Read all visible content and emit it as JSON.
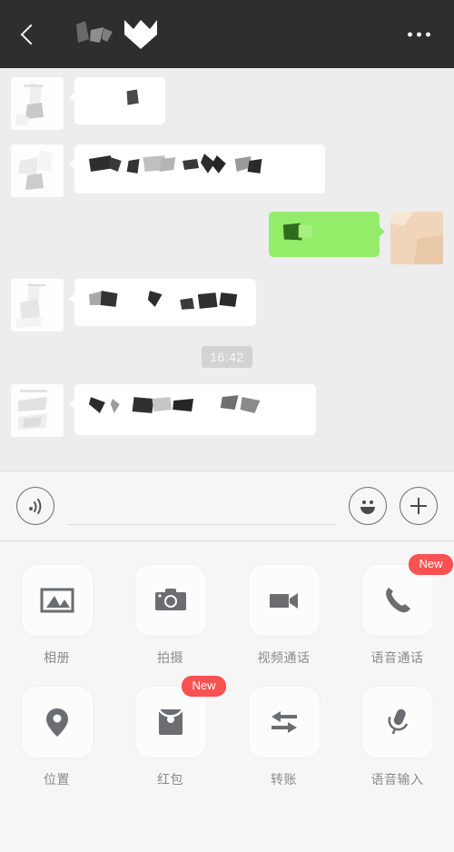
{
  "header": {
    "back_icon": "chevron-left-icon",
    "title_redacted": true,
    "more_icon": "more-horizontal-icon",
    "background_color": "#2e2e2e"
  },
  "chat": {
    "background_color": "#ededed",
    "incoming_bubble_color": "#ffffff",
    "outgoing_bubble_color": "#95ec69",
    "messages": [
      {
        "id": "msg-1",
        "direction": "in",
        "content_redacted": true,
        "bubble_width": 100,
        "bubble_height": 52,
        "avatar_type": "redacted-photo"
      },
      {
        "id": "msg-2",
        "direction": "in",
        "content_redacted": true,
        "bubble_width": 276,
        "bubble_height": 54,
        "avatar_type": "redacted-photo"
      },
      {
        "id": "msg-3",
        "direction": "out",
        "content_redacted": true,
        "bubble_width": 122,
        "bubble_height": 50,
        "avatar_type": "skin-tone-photo"
      },
      {
        "id": "msg-4",
        "direction": "in",
        "content_redacted": true,
        "bubble_width": 200,
        "bubble_height": 52,
        "avatar_type": "redacted-photo"
      }
    ],
    "timestamp": "16:42",
    "timestamp_pill_color": "#d3d3d3",
    "last_message": {
      "id": "msg-5",
      "direction": "in",
      "content_redacted": true,
      "bubble_width": 266,
      "bubble_height": 56,
      "avatar_type": "redacted-photo"
    }
  },
  "input_bar": {
    "voice_icon": "voice-wave-icon",
    "input_value": "",
    "input_placeholder": "",
    "emoji_icon": "smiley-face-icon",
    "plus_icon": "plus-icon",
    "background_color": "#f6f6f6"
  },
  "panel": {
    "background_color": "#f6f6f6",
    "badge_color": "#fa5151",
    "items": [
      {
        "label": "相册",
        "icon": "photo-album-icon",
        "badge": ""
      },
      {
        "label": "拍摄",
        "icon": "camera-icon",
        "badge": ""
      },
      {
        "label": "视频通话",
        "icon": "video-camera-icon",
        "badge": ""
      },
      {
        "label": "语音通话",
        "icon": "phone-icon",
        "badge": "New"
      },
      {
        "label": "位置",
        "icon": "location-pin-icon",
        "badge": ""
      },
      {
        "label": "红包",
        "icon": "red-packet-icon",
        "badge": "New"
      },
      {
        "label": "转账",
        "icon": "transfer-icon",
        "badge": ""
      },
      {
        "label": "语音输入",
        "icon": "microphone-icon",
        "badge": ""
      }
    ]
  }
}
